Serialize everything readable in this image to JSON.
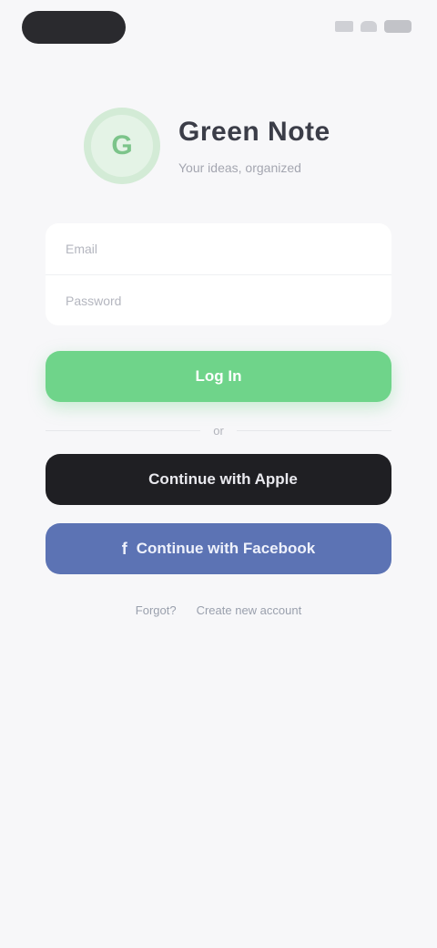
{
  "app": {
    "name": "Green Note",
    "tagline": "Your ideas, organized",
    "logo_text": "G"
  },
  "form": {
    "email": {
      "label": "Email",
      "placeholder": ""
    },
    "password": {
      "label": "Password",
      "placeholder": ""
    }
  },
  "buttons": {
    "login": "Log In",
    "or": "or",
    "apple": "Continue with Apple",
    "facebook": "Continue with Facebook"
  },
  "icons": {
    "apple": "",
    "facebook": "f"
  },
  "footer": {
    "forgot": "Forgot?",
    "signup": "Create new account"
  },
  "colors": {
    "accent": "#6fd48a",
    "apple": "#1f1f23",
    "facebook": "#5c73b4"
  }
}
